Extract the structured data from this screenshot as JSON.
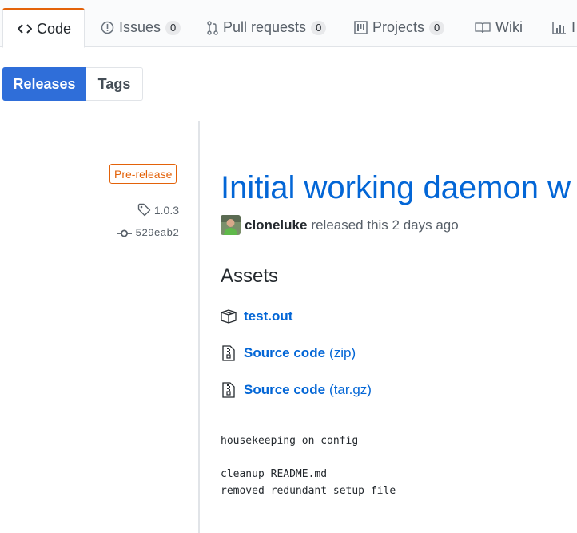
{
  "nav": {
    "tabs": [
      {
        "label": "Code",
        "icon": "code-icon",
        "selected": true
      },
      {
        "label": "Issues",
        "icon": "issue-icon",
        "count": "0"
      },
      {
        "label": "Pull requests",
        "icon": "pull-request-icon",
        "count": "0"
      },
      {
        "label": "Projects",
        "icon": "project-icon",
        "count": "0"
      },
      {
        "label": "Wiki",
        "icon": "book-icon"
      },
      {
        "label": "I",
        "icon": "graph-icon"
      }
    ]
  },
  "subnav": {
    "releases": "Releases",
    "tags": "Tags"
  },
  "release": {
    "prerelease_label": "Pre-release",
    "tag": "1.0.3",
    "commit": "529eab2",
    "title": "Initial working daemon w",
    "author": "cloneluke",
    "released_text": "released this 2 days ago",
    "assets_heading": "Assets",
    "assets": [
      {
        "name": "test.out",
        "ext": ""
      },
      {
        "name": "Source code",
        "ext": "(zip)"
      },
      {
        "name": "Source code",
        "ext": "(tar.gz)"
      }
    ],
    "notes": {
      "line1": "housekeeping on config",
      "line2": "",
      "line3": "cleanup README.md",
      "line4": "removed redundant setup file"
    }
  },
  "colors": {
    "accent": "#e36209",
    "link": "#0366d6",
    "primary_button": "#2f6ed9"
  }
}
